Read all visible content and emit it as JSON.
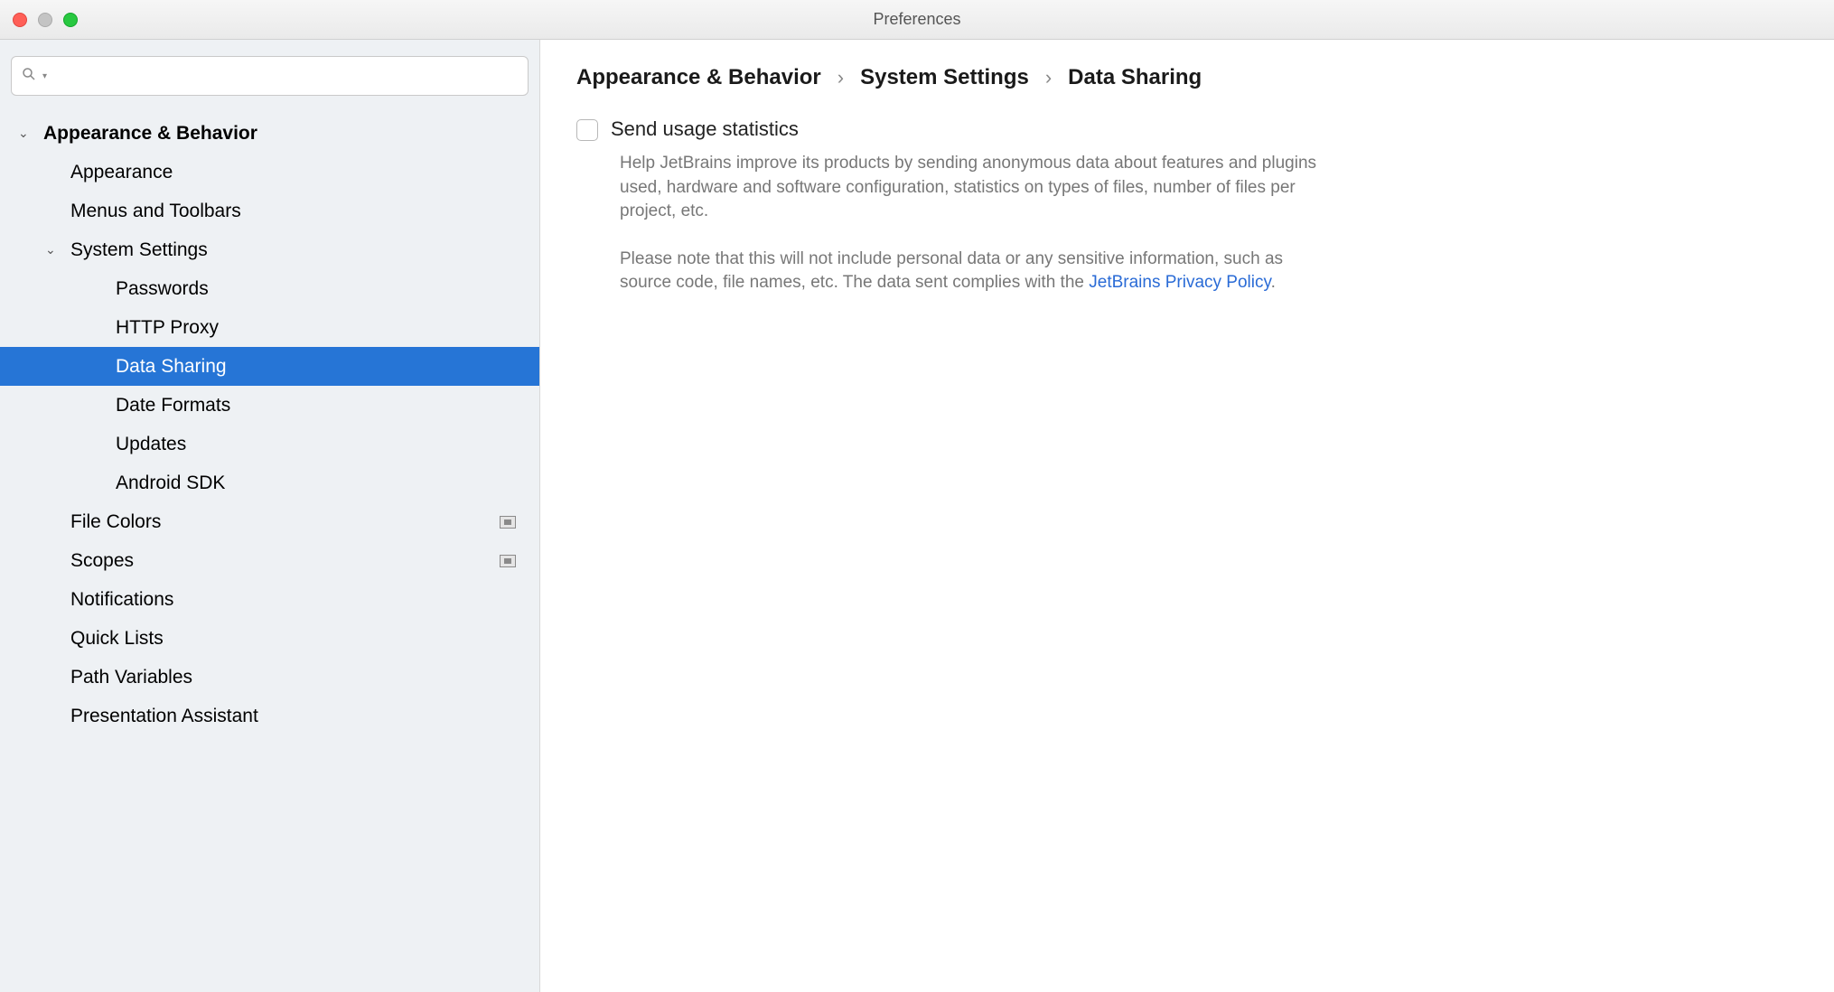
{
  "window": {
    "title": "Preferences"
  },
  "search": {
    "placeholder": ""
  },
  "sidebar": {
    "items": [
      {
        "label": "Appearance & Behavior",
        "level": 0,
        "expanded": true
      },
      {
        "label": "Appearance",
        "level": 1
      },
      {
        "label": "Menus and Toolbars",
        "level": 1
      },
      {
        "label": "System Settings",
        "level": 1,
        "expanded": true
      },
      {
        "label": "Passwords",
        "level": 2
      },
      {
        "label": "HTTP Proxy",
        "level": 2
      },
      {
        "label": "Data Sharing",
        "level": 2,
        "selected": true
      },
      {
        "label": "Date Formats",
        "level": 2
      },
      {
        "label": "Updates",
        "level": 2
      },
      {
        "label": "Android SDK",
        "level": 2
      },
      {
        "label": "File Colors",
        "level": 1,
        "badge": true
      },
      {
        "label": "Scopes",
        "level": 1,
        "badge": true
      },
      {
        "label": "Notifications",
        "level": 1
      },
      {
        "label": "Quick Lists",
        "level": 1
      },
      {
        "label": "Path Variables",
        "level": 1
      },
      {
        "label": "Presentation Assistant",
        "level": 1
      }
    ]
  },
  "breadcrumb": {
    "parts": [
      "Appearance & Behavior",
      "System Settings",
      "Data Sharing"
    ],
    "sep": "›"
  },
  "content": {
    "checkbox_label": "Send usage statistics",
    "desc1": "Help JetBrains improve its products by sending anonymous data about features and plugins used, hardware and software configuration, statistics on types of files, number of files per project, etc.",
    "desc2_prefix": "Please note that this will not include personal data or any sensitive information, such as source code, file names, etc. The data sent complies with the ",
    "desc2_link": "JetBrains Privacy Policy",
    "desc2_suffix": "."
  }
}
